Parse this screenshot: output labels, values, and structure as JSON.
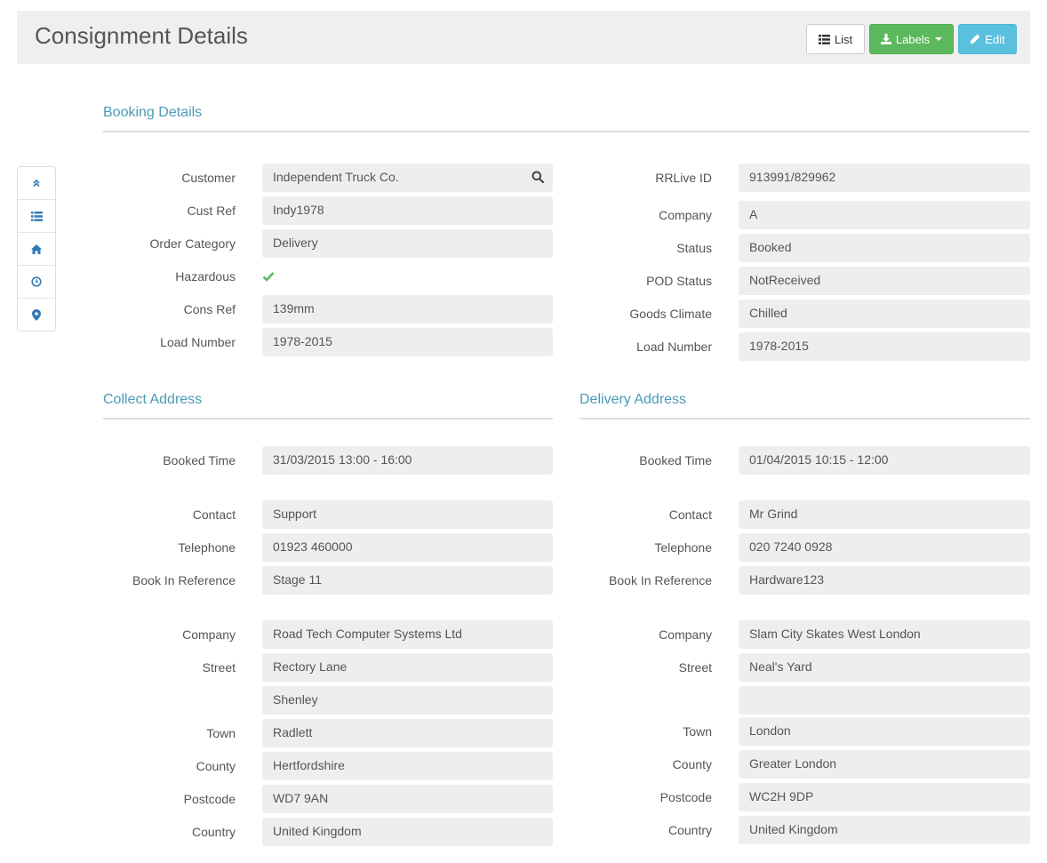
{
  "header": {
    "title": "Consignment Details",
    "list_label": "List",
    "labels_label": "Labels",
    "edit_label": "Edit"
  },
  "sidenav": {
    "items": [
      {
        "icon": "chevron-double-up-icon"
      },
      {
        "icon": "list-icon"
      },
      {
        "icon": "home-icon"
      },
      {
        "icon": "clock-icon"
      },
      {
        "icon": "map-marker-icon"
      }
    ]
  },
  "booking": {
    "heading": "Booking Details",
    "customer_label": "Customer",
    "customer_value": "Independent Truck Co.",
    "cust_ref_label": "Cust Ref",
    "cust_ref_value": "Indy1978",
    "order_category_label": "Order Category",
    "order_category_value": "Delivery",
    "hazardous_label": "Hazardous",
    "hazardous_checked": true,
    "cons_ref_label": "Cons Ref",
    "cons_ref_value": "139mm",
    "load_number_label": "Load Number",
    "load_number_value": "1978-2015",
    "rrlive_id_label": "RRLive ID",
    "rrlive_id_value": "913991/829962",
    "company_label": "Company",
    "company_value": "A",
    "status_label": "Status",
    "status_value": "Booked",
    "pod_status_label": "POD Status",
    "pod_status_value": "NotReceived",
    "goods_climate_label": "Goods Climate",
    "goods_climate_value": "Chilled",
    "load_number2_label": "Load Number",
    "load_number2_value": "1978-2015"
  },
  "collect": {
    "heading": "Collect Address",
    "booked_time_label": "Booked Time",
    "booked_time_value": "31/03/2015 13:00 - 16:00",
    "contact_label": "Contact",
    "contact_value": "Support",
    "telephone_label": "Telephone",
    "telephone_value": "01923 460000",
    "book_in_ref_label": "Book In Reference",
    "book_in_ref_value": "Stage 11",
    "company_label": "Company",
    "company_value": "Road Tech Computer Systems Ltd",
    "street_label": "Street",
    "street_value": "Rectory Lane",
    "street2_value": "Shenley",
    "town_label": "Town",
    "town_value": "Radlett",
    "county_label": "County",
    "county_value": "Hertfordshire",
    "postcode_label": "Postcode",
    "postcode_value": "WD7 9AN",
    "country_label": "Country",
    "country_value": "United Kingdom"
  },
  "delivery": {
    "heading": "Delivery Address",
    "booked_time_label": "Booked Time",
    "booked_time_value": "01/04/2015 10:15 - 12:00",
    "contact_label": "Contact",
    "contact_value": "Mr Grind",
    "telephone_label": "Telephone",
    "telephone_value": "020 7240 0928",
    "book_in_ref_label": "Book In Reference",
    "book_in_ref_value": "Hardware123",
    "company_label": "Company",
    "company_value": "Slam City Skates West London",
    "street_label": "Street",
    "street_value": "Neal's Yard",
    "street2_value": "",
    "town_label": "Town",
    "town_value": "London",
    "county_label": "County",
    "county_value": "Greater London",
    "postcode_label": "Postcode",
    "postcode_value": "WC2H 9DP",
    "country_label": "Country",
    "country_value": "United Kingdom"
  },
  "colors": {
    "accent": "#4a9bb5",
    "success": "#5cb85c",
    "info": "#5bc0de",
    "icon_blue": "#337ab7",
    "field_bg": "#eeeeee"
  }
}
